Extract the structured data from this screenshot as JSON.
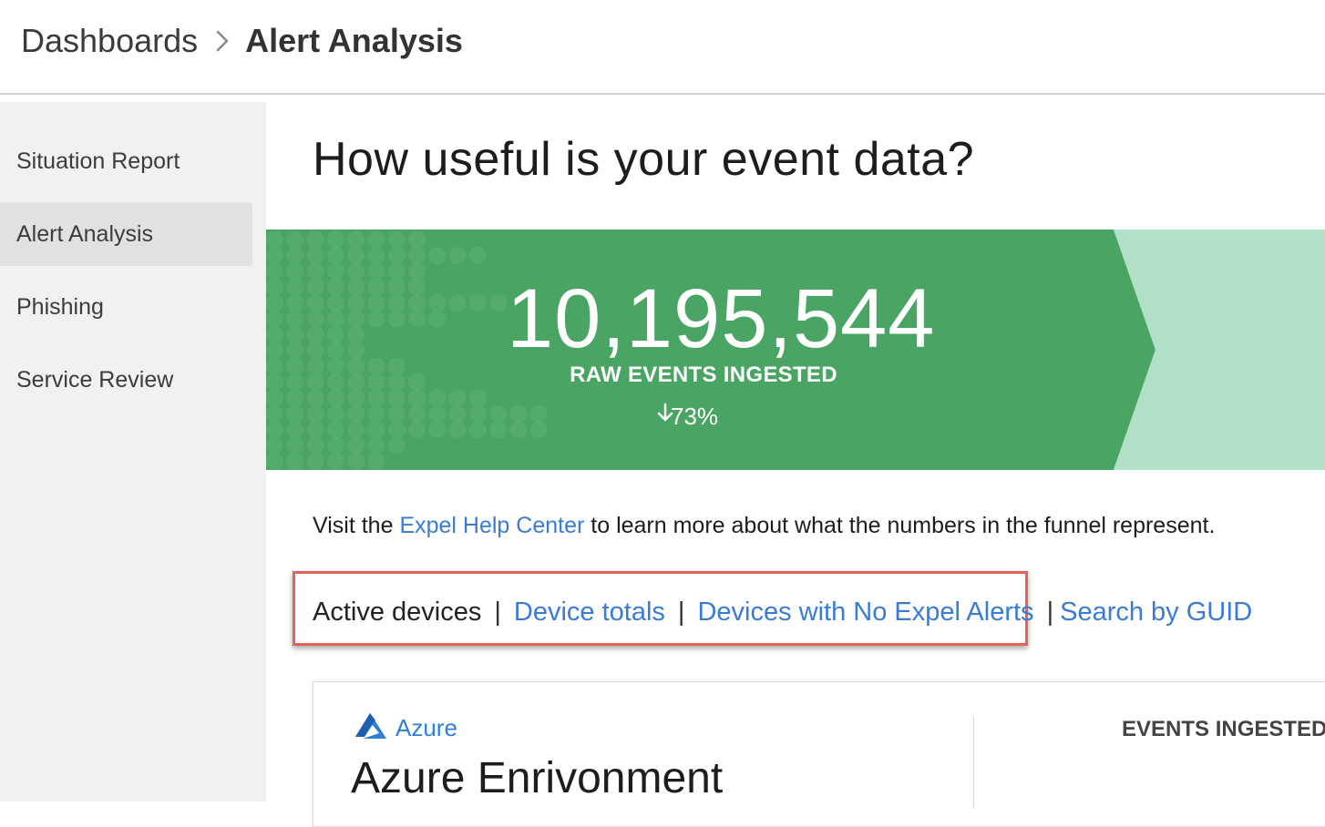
{
  "breadcrumb": {
    "root": "Dashboards",
    "current": "Alert Analysis"
  },
  "sidebar": {
    "items": [
      {
        "label": "Situation Report",
        "active": false
      },
      {
        "label": "Alert Analysis",
        "active": true
      },
      {
        "label": "Phishing",
        "active": false
      },
      {
        "label": "Service Review",
        "active": false
      }
    ]
  },
  "main": {
    "title": "How useful is your event data?",
    "funnel": {
      "value": "10,195,544",
      "label": "RAW EVENTS INGESTED",
      "change": "73%",
      "change_direction": "down",
      "color_primary": "#4aa564",
      "color_secondary": "#b2dfc7"
    },
    "help": {
      "prefix": "Visit the ",
      "link": "Expel Help Center",
      "suffix": " to learn more about what the numbers in the funnel represent."
    },
    "tabs": {
      "active": "Active devices",
      "device_totals": "Device totals",
      "no_alerts": "Devices with No Expel Alerts",
      "search_guid": "Search by GUID",
      "separator": "|"
    },
    "card": {
      "brand": "Azure",
      "title": "Azure Enrivonment",
      "stat_label": "EVENTS INGESTED"
    }
  },
  "colors": {
    "link": "#3a7bd5",
    "highlight_border": "#e0645a",
    "sidebar_bg": "#f1f1f1",
    "sidebar_active_bg": "#e1e1e1"
  }
}
